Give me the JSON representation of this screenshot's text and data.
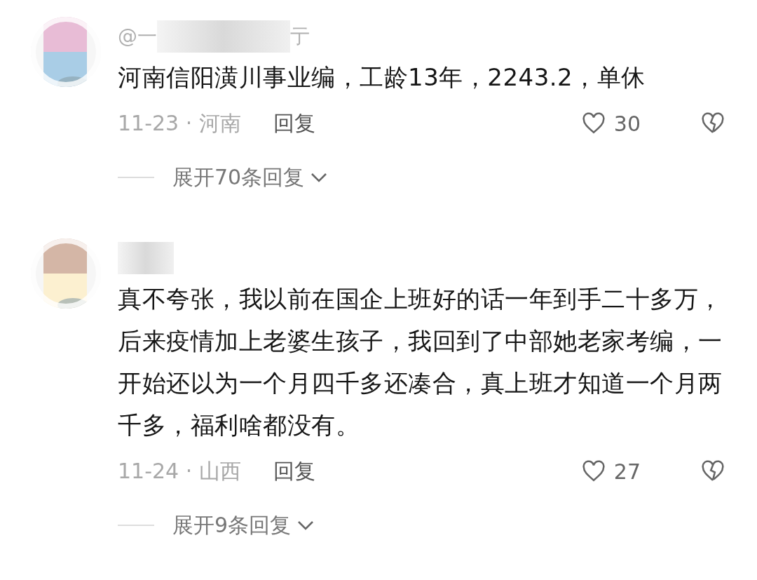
{
  "comments": [
    {
      "user_parts": [
        "@一",
        "亍"
      ],
      "text": "河南信阳潢川事业编，工龄13年，2243.2，单休",
      "meta": "11-23 · 河南",
      "reply": "回复",
      "likes": "30",
      "expand": "展开70条回复"
    },
    {
      "text": "真不夸张，我以前在国企上班好的话一年到手二十多万，后来疫情加上老婆生孩子，我回到了中部她老家考编，一开始还以为一个月四千多还凑合，真上班才知道一个月两千多，福利啥都没有。",
      "meta": "11-24 · 山西",
      "reply": "回复",
      "likes": "27",
      "expand": "展开9条回复"
    }
  ]
}
